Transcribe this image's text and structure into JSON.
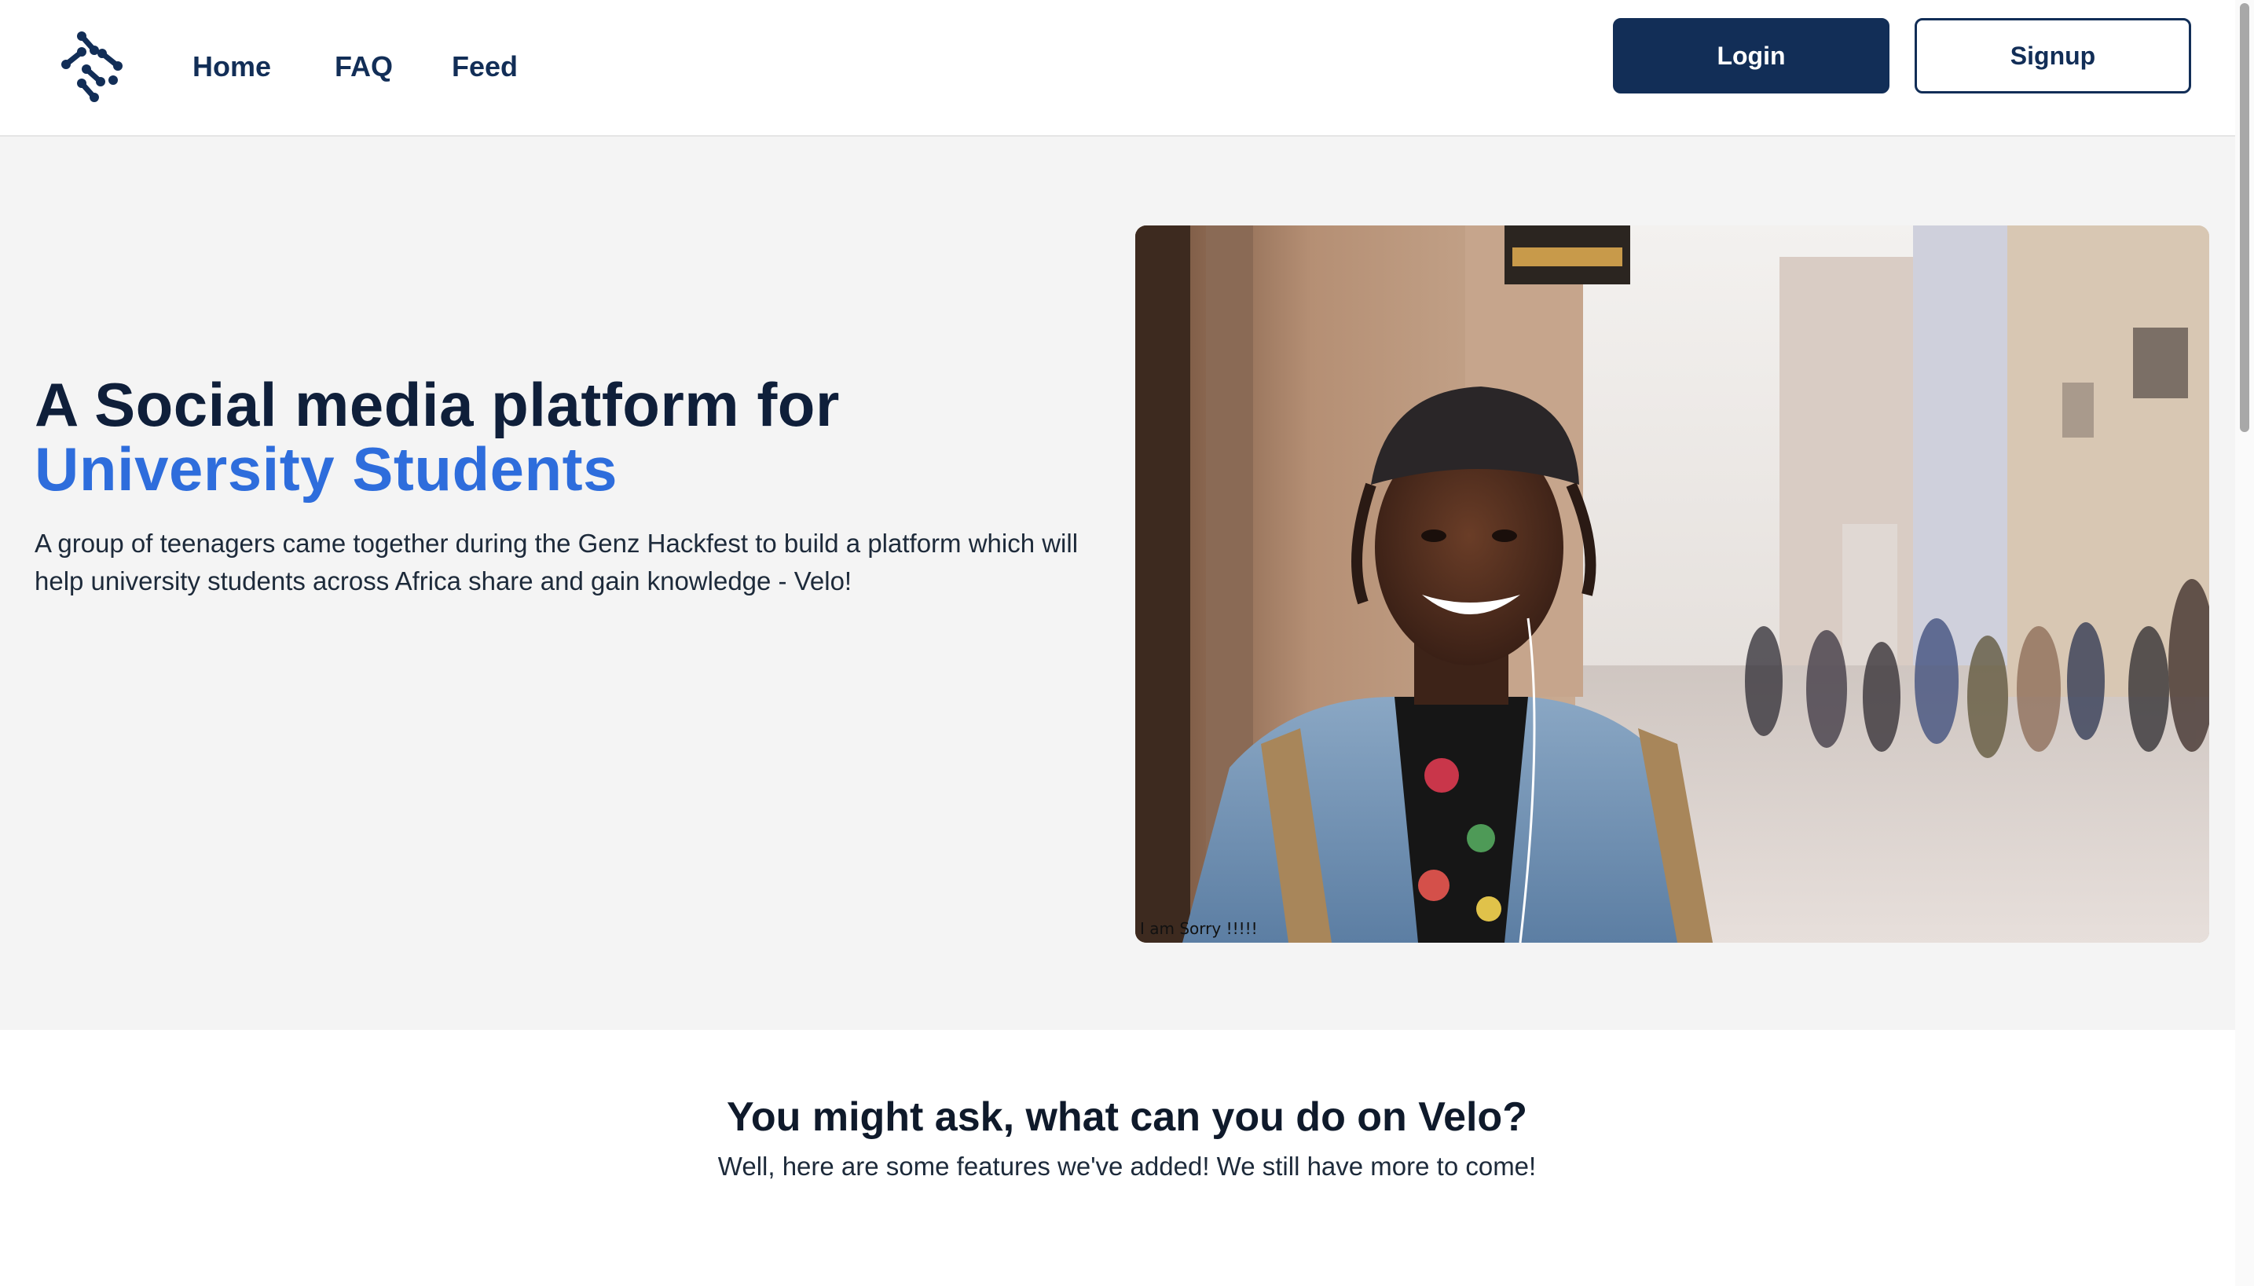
{
  "header": {
    "logo_icon": "velo-molecule-logo-icon",
    "nav": [
      {
        "label": "Home"
      },
      {
        "label": "FAQ"
      },
      {
        "label": "Feed"
      }
    ],
    "login_label": "Login",
    "signup_label": "Signup"
  },
  "hero": {
    "title_line1": "A Social media platform for",
    "title_line2": "University Students",
    "description": "A group of teenagers came together during the Genz Hackfest to build a platform which will help university students across Africa share and gain knowledge - Velo!",
    "image_caption": "I am Sorry !!!!!"
  },
  "features": {
    "title": "You might ask, what can you do on Velo?",
    "subtitle": "Well, here are some features we've added! We still have more to come!"
  },
  "colors": {
    "brand_navy": "#122e57",
    "accent_blue": "#2e6ddc",
    "hero_bg": "#f4f4f4"
  }
}
